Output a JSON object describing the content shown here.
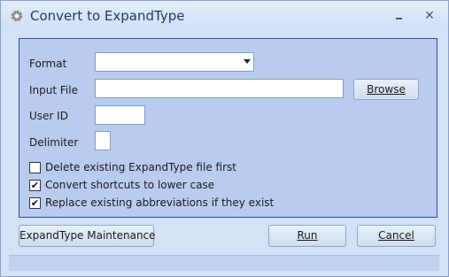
{
  "window": {
    "title": "Convert to ExpandType",
    "minimize_glyph": "",
    "close_glyph": "✕",
    "icon": "gear-icon"
  },
  "form": {
    "format_label": "Format",
    "format_value": "",
    "input_file_label": "Input File",
    "input_file_value": "",
    "browse_label": "Browse",
    "user_id_label": "User ID",
    "user_id_value": "",
    "delimiter_label": "Delimiter",
    "delimiter_value": ""
  },
  "options": [
    {
      "label": "Delete existing ExpandType file first",
      "checked": false
    },
    {
      "label": "Convert shortcuts to lower case",
      "checked": true
    },
    {
      "label": "Replace existing abbreviations if they exist",
      "checked": true
    }
  ],
  "buttons": {
    "maintenance_label": "ExpandType Maintenance",
    "run_label": "Run",
    "cancel_label": "Cancel"
  },
  "colors": {
    "window_bg": "#d3e2f7",
    "panel_bg": "#b9ccef",
    "panel_border": "#2a4e99",
    "title_text": "#1e3a66"
  }
}
